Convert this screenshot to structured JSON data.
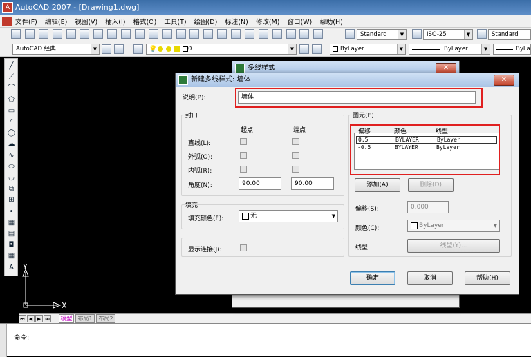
{
  "app": {
    "title": "AutoCAD 2007 - [Drawing1.dwg]"
  },
  "menu": [
    "文件(F)",
    "编辑(E)",
    "视图(V)",
    "插入(I)",
    "格式(O)",
    "工具(T)",
    "绘图(D)",
    "标注(N)",
    "修改(M)",
    "窗口(W)",
    "帮助(H)"
  ],
  "toolbar": {
    "text_style": "Standard",
    "dim_style": "ISO-25",
    "table_style": "Standard",
    "workspace": "AutoCAD 经典",
    "layer": "0",
    "color": "ByLayer",
    "linetype": "ByLayer",
    "lineweight": "ByLayer"
  },
  "left_icons": [
    "line-icon",
    "xline-icon",
    "pline-icon",
    "polygon-icon",
    "rectangle-icon",
    "arc-icon",
    "circle-icon",
    "revcloud-icon",
    "spline-icon",
    "ellipse-icon",
    "ellipse-arc-icon",
    "insert-block-icon",
    "make-block-icon",
    "point-icon",
    "hatch-icon",
    "gradient-icon",
    "region-icon",
    "table-icon",
    "mtext-icon"
  ],
  "left_glyphs": [
    "╱",
    "⟋",
    "⌒",
    "⬠",
    "▭",
    "◜",
    "◯",
    "☁",
    "∿",
    "⬭",
    "◡",
    "⧉",
    "⊞",
    "•",
    "▦",
    "▤",
    "◘",
    "▦",
    "A"
  ],
  "canvas": {
    "axis_x": "X",
    "axis_y": "Y"
  },
  "tabs": {
    "nav": [
      "⏮",
      "◀",
      "▶",
      "⏭"
    ],
    "model": "模型",
    "layout1": "布局1",
    "layout2": "布局2"
  },
  "command": {
    "prompt": "命令:"
  },
  "parent_dialog": {
    "title": "多线样式",
    "close": "✕"
  },
  "dialog": {
    "title": "新建多线样式: 墙体",
    "close": "✕",
    "description_label": "说明(P):",
    "description_value": "墙体",
    "caps": {
      "group_label": "封口",
      "start_label": "起点",
      "end_label": "端点",
      "line_label": "直线(L):",
      "outer_arc_label": "外弧(O):",
      "inner_arc_label": "内弧(R):",
      "angle_label": "角度(N):",
      "angle_start": "90.00",
      "angle_end": "90.00"
    },
    "fill": {
      "group_label": "填充",
      "color_label": "填充颜色(F):",
      "color_value": "无"
    },
    "joints_label": "显示连接(J):",
    "elements": {
      "group_label": "图元(E)",
      "headers": [
        "偏移",
        "颜色",
        "线型"
      ],
      "rows": [
        {
          "offset": "0.5",
          "color": "BYLAYER",
          "linetype": "ByLayer"
        },
        {
          "offset": "-0.5",
          "color": "BYLAYER",
          "linetype": "ByLayer"
        }
      ],
      "add_button": "添加(A)",
      "delete_button": "删除(D)",
      "offset_label": "偏移(S):",
      "offset_value": "0.000",
      "color_label": "颜色(C):",
      "color_value": "ByLayer",
      "linetype_label": "线型:",
      "linetype_button": "线型(Y)..."
    },
    "ok_button": "确定",
    "cancel_button": "取消",
    "help_button": "帮助(H)"
  }
}
